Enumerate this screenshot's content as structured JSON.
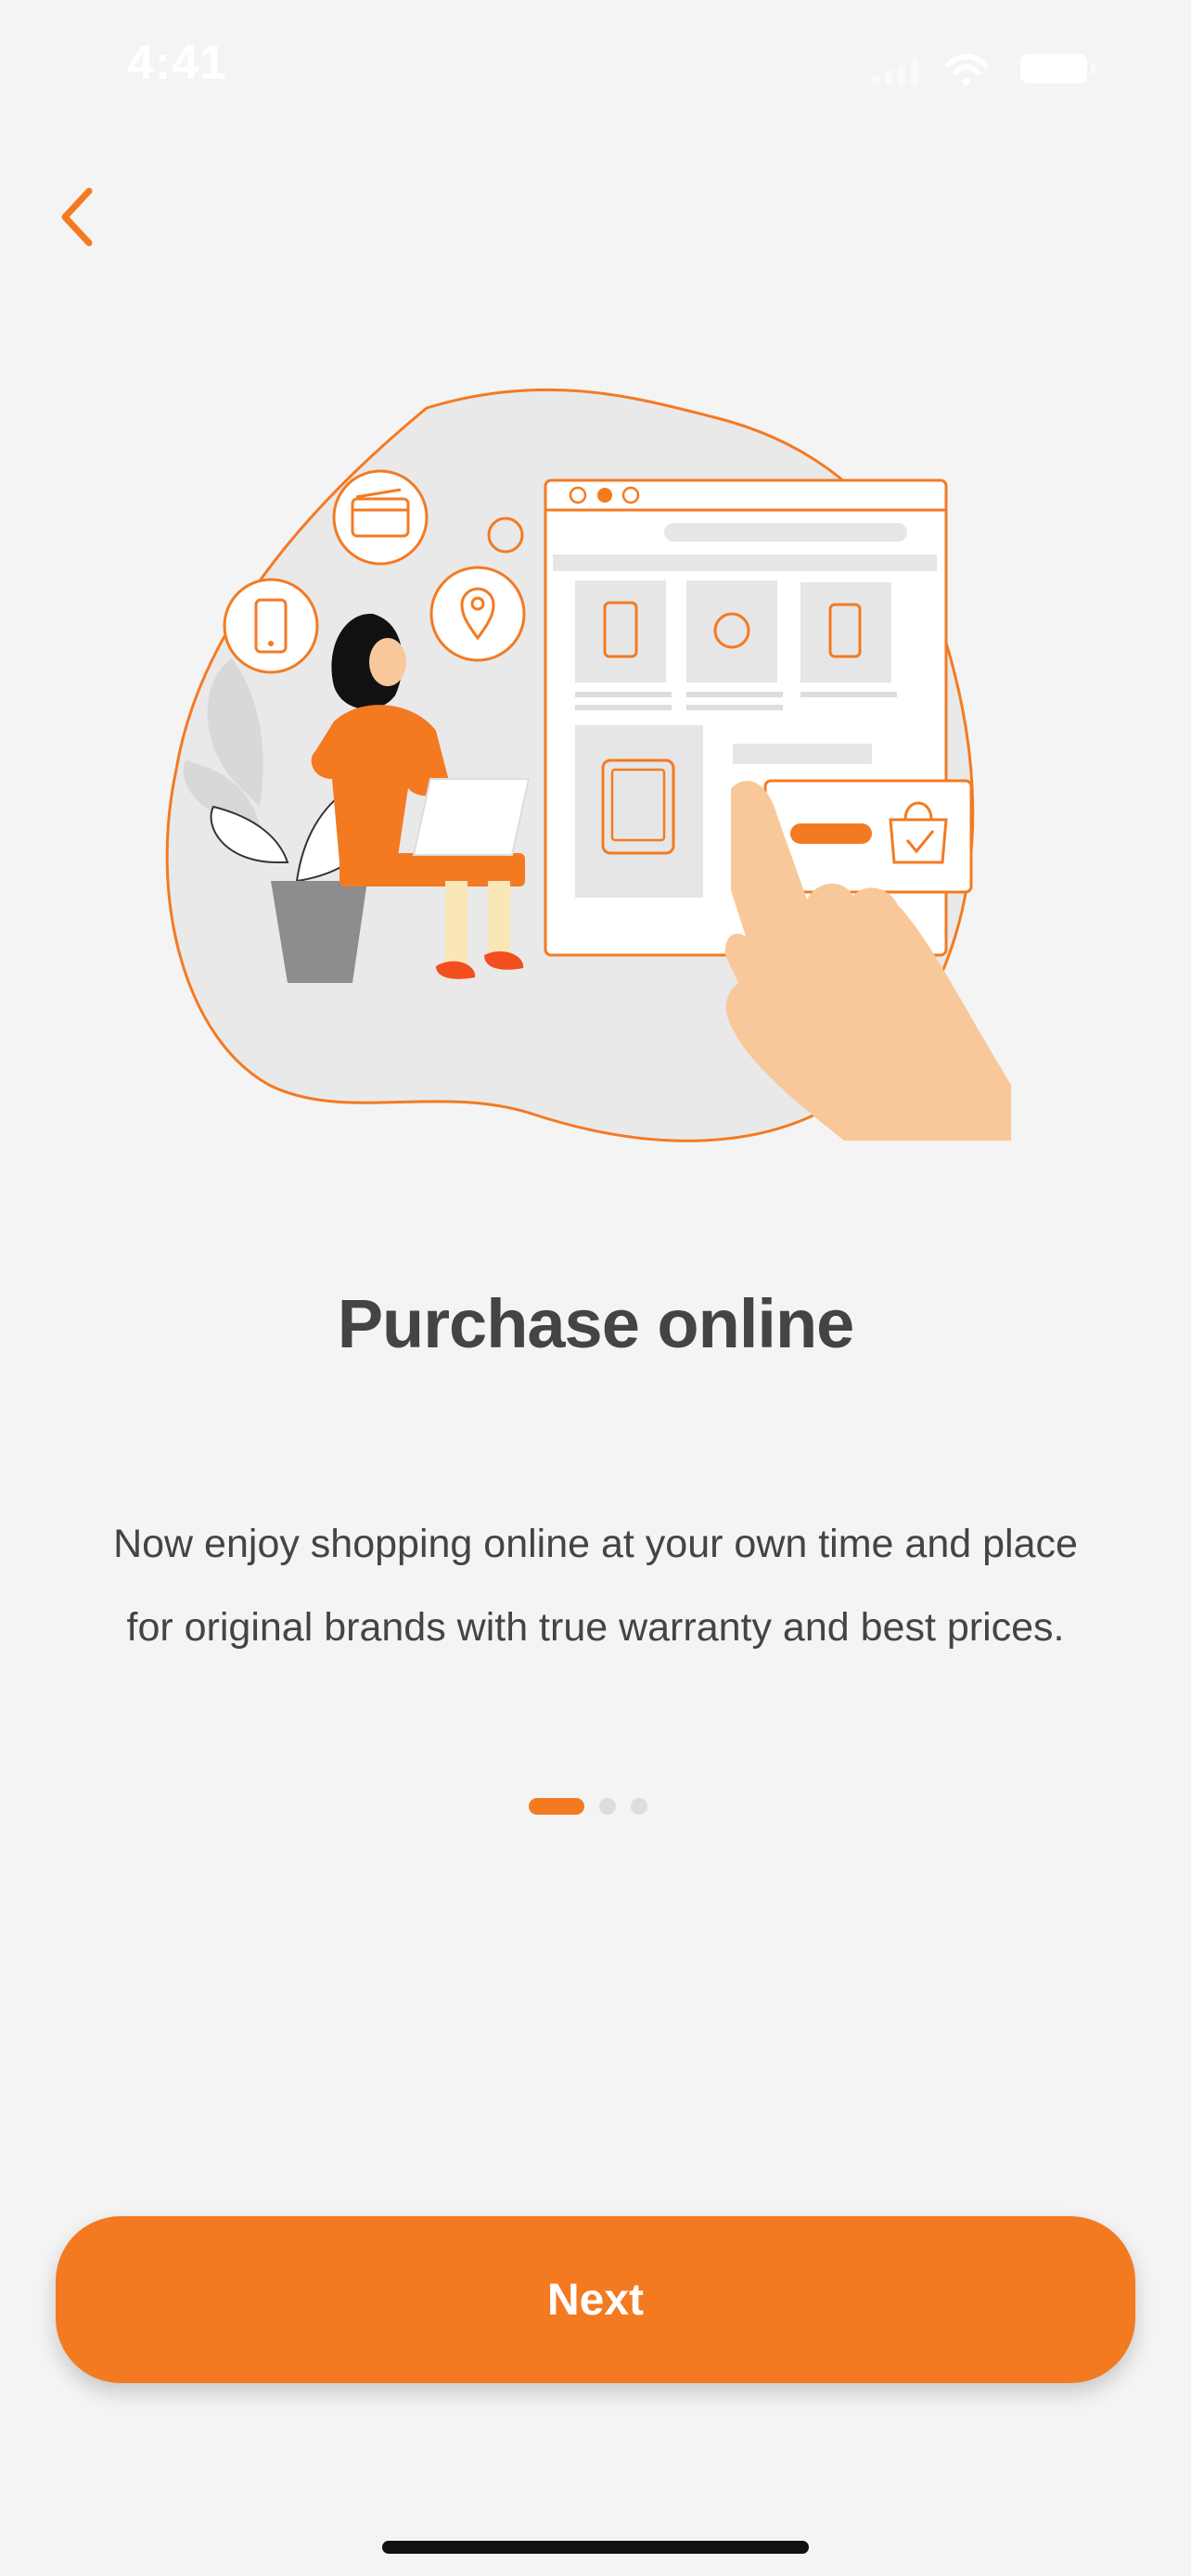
{
  "status_bar": {
    "time": "4:41"
  },
  "onboarding": {
    "title": "Purchase online",
    "description": "Now enjoy shopping online at your own time and place for original brands with true warranty and best prices.",
    "page_count": 3,
    "active_page": 1
  },
  "next_button": {
    "label": "Next"
  },
  "colors": {
    "accent": "#f47a21",
    "text": "#444444",
    "background": "#f4f4f4"
  },
  "icons": [
    "back-chevron-icon",
    "wifi-icon",
    "battery-icon",
    "signal-icon"
  ]
}
